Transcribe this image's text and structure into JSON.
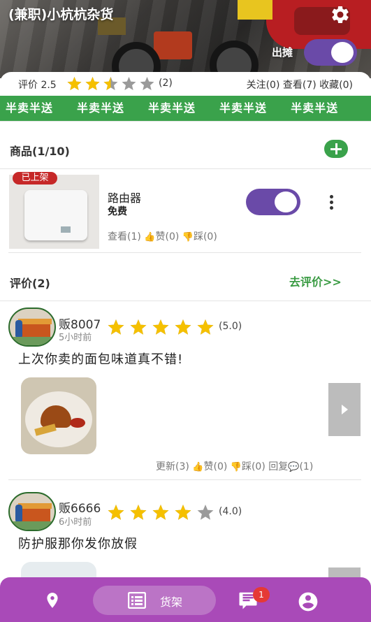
{
  "header": {
    "store_title": "(兼职)小杭杭杂货",
    "stall_label": "出摊",
    "stall_on": true,
    "settings_icon": "gear-icon"
  },
  "rating": {
    "label": "评价",
    "score": "2.5",
    "stars": 2.5,
    "count": "(2)",
    "stats": "关注(0) 查看(7) 收藏(0)"
  },
  "marquee": {
    "items": [
      "半卖半送",
      "半卖半送",
      "半卖半送",
      "半卖半送",
      "半卖半送"
    ]
  },
  "products": {
    "header": "商品(1/10)",
    "add_icon": "plus-icon",
    "items": [
      {
        "badge": "已上架",
        "name": "路由器",
        "price": "免费",
        "listed": true,
        "meta": {
          "views": "查看(1)",
          "likes": "赞(0)",
          "dislikes": "踩(0)"
        }
      }
    ]
  },
  "reviews": {
    "header": "评价(2)",
    "write_link": "去评价>>",
    "items": [
      {
        "name": "贩8007",
        "time": "5小时前",
        "stars": 5,
        "score": "(5.0)",
        "text": "上次你卖的面包味道真不错!",
        "meta": {
          "updates": "更新(3)",
          "likes": "赞(0)",
          "dislikes": "踩(0)",
          "reply": "回复",
          "replies": "(1)"
        }
      },
      {
        "name": "贩6666",
        "time": "6小时前",
        "stars": 4,
        "score": "(4.0)",
        "text": "防护服那你发你放假"
      }
    ]
  },
  "nav": {
    "location_icon": "location-pin-icon",
    "shelf_label": "货架",
    "shelf_icon": "list-icon",
    "message_icon": "message-icon",
    "message_badge": "1",
    "profile_icon": "account-icon"
  },
  "colors": {
    "accent_purple": "#6a4aa8",
    "nav_purple": "#a94ab8",
    "green": "#3aa24b",
    "star_gold": "#f5c000",
    "star_gray": "#9a9a9a",
    "badge_red": "#c62828"
  }
}
